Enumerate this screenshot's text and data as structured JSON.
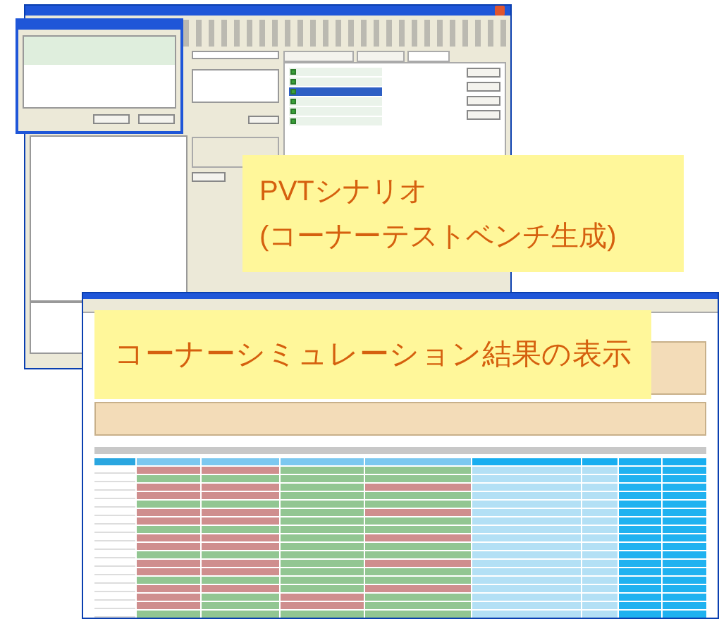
{
  "callouts": [
    {
      "lines": [
        "PVTシナリオ",
        "(コーナーテストベンチ生成)"
      ]
    },
    {
      "lines": [
        "コーナーシミュレーション結果の表示"
      ]
    }
  ],
  "editor_window": {
    "tabs": [
      {
        "selected": false
      },
      {
        "selected": false
      },
      {
        "selected": true
      }
    ],
    "scenario_list": [
      {
        "checked": true,
        "selected": false
      },
      {
        "checked": true,
        "selected": false
      },
      {
        "checked": true,
        "selected": true
      },
      {
        "checked": true,
        "selected": false
      },
      {
        "checked": true,
        "selected": false
      },
      {
        "checked": true,
        "selected": false
      }
    ]
  },
  "results_window": {
    "rows": [
      {
        "pass": [
          false,
          false,
          true,
          true
        ]
      },
      {
        "pass": [
          true,
          true,
          true,
          true
        ]
      },
      {
        "pass": [
          false,
          false,
          true,
          false
        ]
      },
      {
        "pass": [
          false,
          false,
          true,
          true
        ]
      },
      {
        "pass": [
          true,
          true,
          true,
          true
        ]
      },
      {
        "pass": [
          false,
          false,
          true,
          false
        ]
      },
      {
        "pass": [
          false,
          false,
          true,
          true
        ]
      },
      {
        "pass": [
          true,
          true,
          true,
          true
        ]
      },
      {
        "pass": [
          false,
          false,
          true,
          false
        ]
      },
      {
        "pass": [
          false,
          false,
          true,
          true
        ]
      },
      {
        "pass": [
          true,
          true,
          true,
          true
        ]
      },
      {
        "pass": [
          false,
          false,
          true,
          false
        ]
      },
      {
        "pass": [
          false,
          false,
          true,
          true
        ]
      },
      {
        "pass": [
          true,
          true,
          true,
          true
        ]
      },
      {
        "pass": [
          false,
          false,
          true,
          false
        ]
      },
      {
        "pass": [
          false,
          true,
          false,
          true
        ]
      },
      {
        "pass": [
          false,
          true,
          false,
          true
        ]
      },
      {
        "pass": [
          true,
          true,
          true,
          true
        ]
      }
    ]
  }
}
